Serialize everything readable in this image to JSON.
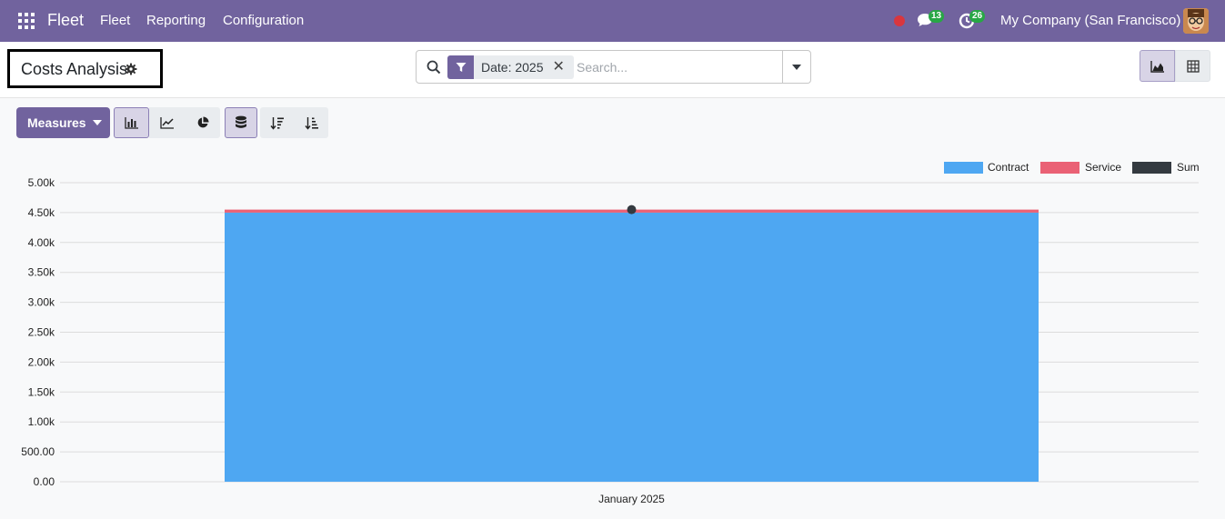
{
  "navbar": {
    "brand": "Fleet",
    "menu": [
      "Fleet",
      "Reporting",
      "Configuration"
    ],
    "messages_badge": "13",
    "activities_badge": "26",
    "company": "My Company (San Francisco)"
  },
  "control_panel": {
    "title": "Costs Analysis",
    "search": {
      "facet_label": "Date: 2025",
      "placeholder": "Search..."
    }
  },
  "toolbar": {
    "measures_label": "Measures"
  },
  "colors": {
    "brand": "#71639e",
    "contract": "#4ea7f2",
    "service": "#ea6175",
    "sum": "#343a40"
  },
  "chart_data": {
    "type": "area",
    "categories": [
      "January 2025"
    ],
    "series": [
      {
        "name": "Contract",
        "values": [
          4500
        ]
      },
      {
        "name": "Service",
        "values": [
          50
        ]
      },
      {
        "name": "Sum",
        "values": [
          4550
        ]
      }
    ],
    "stacked": true,
    "ylim": [
      0,
      5000
    ],
    "yticks": [
      "0.00",
      "500.00",
      "1.00k",
      "1.50k",
      "2.00k",
      "2.50k",
      "3.00k",
      "3.50k",
      "4.00k",
      "4.50k",
      "5.00k"
    ],
    "legend": "top-right",
    "grid": true
  }
}
